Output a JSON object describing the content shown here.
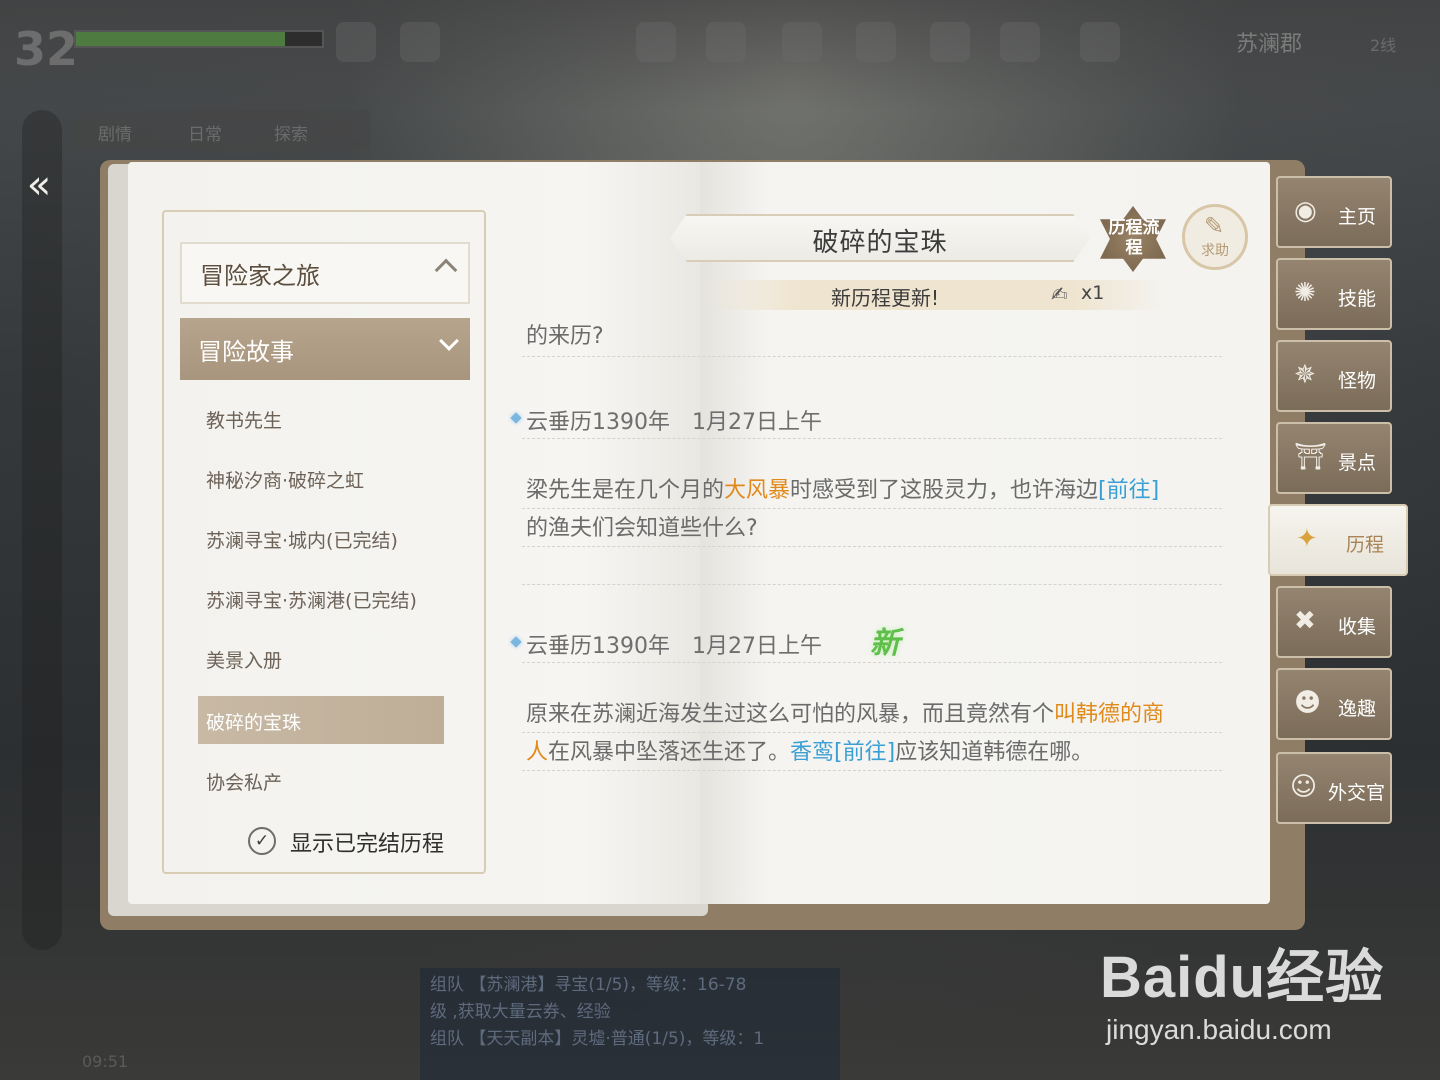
{
  "hud": {
    "level": "32",
    "city": "苏澜郡",
    "server_line": "2线",
    "quest_tabs": [
      "剧情",
      "日常",
      "探索"
    ],
    "clock": "09:51",
    "hp_fraction": 0.85
  },
  "book": {
    "category_header": "冒险家之旅",
    "category_selected": "冒险故事",
    "stories": [
      {
        "label": "教书先生"
      },
      {
        "label": "神秘汐商·破碎之虹"
      },
      {
        "label": "苏澜寻宝·城内(已完结)"
      },
      {
        "label": "苏澜寻宝·苏澜港(已完结)"
      },
      {
        "label": "美景入册"
      },
      {
        "label": "破碎的宝珠"
      },
      {
        "label": "协会私产"
      }
    ],
    "active_story": "破碎的宝珠",
    "show_completed_label": "显示已完结历程",
    "title": "破碎的宝珠",
    "process_badge": "历程流程",
    "help_label": "求助",
    "update_text": "新历程更新!",
    "update_count": "x1",
    "partial_line": "的来历?",
    "entries": [
      {
        "date": "云垂历1390年　1月27日上午",
        "parts": [
          {
            "t": "梁先生是在几个月的",
            "c": ""
          },
          {
            "t": "大风暴",
            "c": "orange"
          },
          {
            "t": "时感受到了这股灵力，也许海边",
            "c": ""
          },
          {
            "t": "[前往]",
            "c": "blue"
          }
        ],
        "line2": "的渔夫们会知道些什么?"
      },
      {
        "date": "云垂历1390年　1月27日上午",
        "new_badge": "新",
        "line1_a": "原来在苏澜近海发生过这么可怕的风暴，而且竟然有个",
        "line1_b": "叫韩德的商",
        "line2_a": "人",
        "line2_b": "在风暴中坠落还生还了。",
        "line2_c": "香鸾[前往]",
        "line2_d": "应该知道韩德在哪。"
      }
    ]
  },
  "side_tabs": [
    {
      "label": "主页",
      "icon": "home-icon"
    },
    {
      "label": "技能",
      "icon": "skill-icon"
    },
    {
      "label": "怪物",
      "icon": "monster-icon"
    },
    {
      "label": "景点",
      "icon": "landmark-icon"
    },
    {
      "label": "历程",
      "icon": "journey-icon",
      "active": true
    },
    {
      "label": "收集",
      "icon": "collection-icon"
    },
    {
      "label": "逸趣",
      "icon": "fun-icon"
    },
    {
      "label": "外交官",
      "icon": "diplomat-icon"
    }
  ],
  "chat": {
    "line1": "组队 【苏澜港】寻宝(1/5)，等级：16-78",
    "line2": "级 ,获取大量云券、经验",
    "line3": "组队 【天天副本】灵墟·普通(1/5)，等级：1"
  },
  "watermark": {
    "logo": "Baidu经验",
    "url": "jingyan.baidu.com"
  },
  "colors": {
    "accent_orange": "#e08a1c",
    "link_blue": "#3a9fd4",
    "new_green": "#5fbf4b",
    "tab_brown": "#8a7a65"
  }
}
